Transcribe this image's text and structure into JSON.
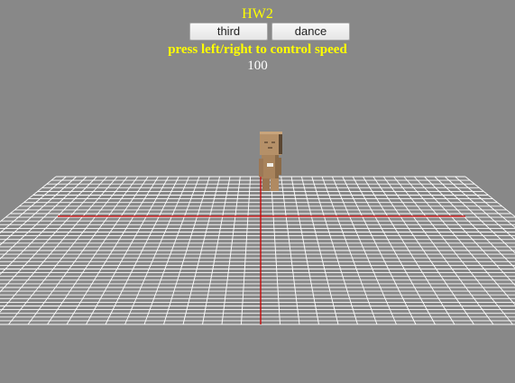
{
  "app": {
    "title": "HW2"
  },
  "controls": {
    "third_label": "third",
    "dance_label": "dance"
  },
  "instructions": "press left/right to control speed",
  "speed_value": "100",
  "colors": {
    "background": "#888888",
    "grid": "#ffffff",
    "axis": "#cc0000",
    "title_text": "#ffff00",
    "speed_text": "#ffffff",
    "character_body": "#a07e5a"
  },
  "scene": {
    "grid_lines_per_axis": 41,
    "character": "cardboard-robot-figure"
  }
}
